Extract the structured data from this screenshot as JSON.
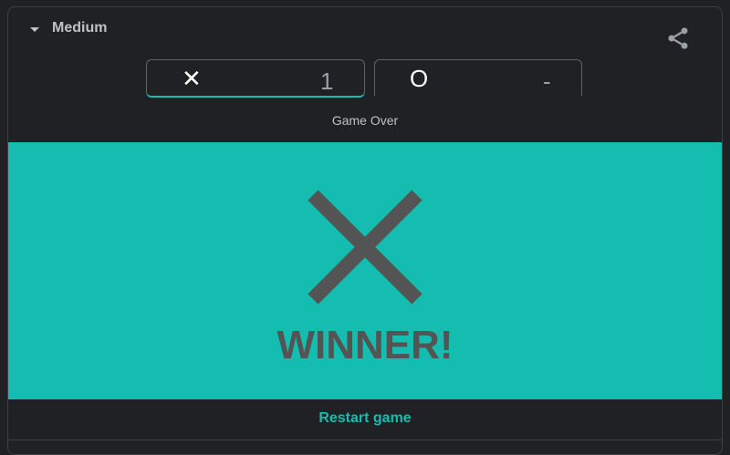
{
  "header": {
    "difficulty_label": "Medium",
    "share_icon": "share-icon"
  },
  "scores": {
    "x": {
      "symbol": "✕",
      "value": "1"
    },
    "o": {
      "symbol": "O",
      "value": "-"
    }
  },
  "status_text": "Game Over",
  "result": {
    "winner_symbol": "X",
    "winner_text": "WINNER!"
  },
  "restart_label": "Restart game",
  "colors": {
    "background": "#202124",
    "accent": "#15bdb0",
    "mark": "#545454",
    "text": "#bdc1c6"
  }
}
